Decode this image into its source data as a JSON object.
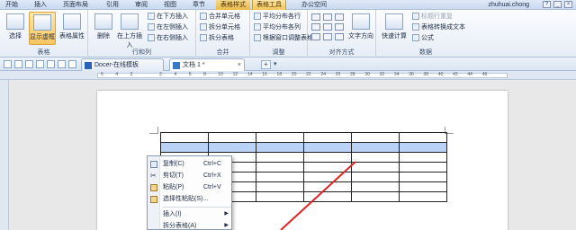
{
  "menu_tabs": [
    {
      "label": "开始"
    },
    {
      "label": "插入"
    },
    {
      "label": "页面布局"
    },
    {
      "label": "引用"
    },
    {
      "label": "审阅"
    },
    {
      "label": "视图"
    },
    {
      "label": "章节"
    },
    {
      "label": "表格样式"
    },
    {
      "label": "表格工具"
    },
    {
      "label": "办公空间"
    }
  ],
  "user": "zhuhuai.chong",
  "ribbon": {
    "select": "选择",
    "show_gridlines": "显示虚框",
    "table_properties": "表格属性",
    "group_table": "表格",
    "delete": "删除",
    "insert_above": "在上方插入",
    "insert_below": "在下方插入",
    "insert_left": "在左侧插入",
    "insert_right": "在右侧插入",
    "group_rows_cols": "行和列",
    "merge_cells": "合并单元格",
    "split_cells": "拆分单元格",
    "split_table": "拆分表格",
    "group_merge": "合并",
    "distribute_rows": "平均分布各行",
    "distribute_cols": "平均分布各列",
    "autofit_window": "根据窗口调整表格",
    "group_adjust": "调整",
    "text_direction": "文字方向",
    "group_alignment": "对齐方式",
    "quick_calc": "快速计算",
    "repeat_header": "标题行重复",
    "convert_to_text": "表格转换成文本",
    "formula": "公式",
    "group_data": "数据"
  },
  "doc_tabs": [
    {
      "label": "Docer-在线模板"
    },
    {
      "label": "文档 1 *"
    }
  ],
  "ruler_numbers": [
    "6",
    "4",
    "2",
    "",
    "2",
    "4",
    "6",
    "8",
    "10",
    "12",
    "14",
    "16",
    "18",
    "20",
    "22",
    "24",
    "26",
    "28",
    "30",
    "32",
    "34",
    "36",
    "38",
    "40",
    "42",
    "44",
    "46"
  ],
  "table": {
    "rows": 7,
    "cols": 6,
    "selected_row": 1
  },
  "context_menu": [
    {
      "label": "复制(C)",
      "shortcut": "Ctrl+C"
    },
    {
      "label": "剪切(T)",
      "shortcut": "Ctrl+X"
    },
    {
      "label": "粘贴(P)",
      "shortcut": "Ctrl+V"
    },
    {
      "label": "选择性粘贴(S)...",
      "shortcut": ""
    },
    {
      "label": "插入(I)",
      "shortcut": ""
    },
    {
      "label": "拆分表格(A)",
      "shortcut": ""
    }
  ],
  "colors": {
    "annotation_line": "#e02424",
    "selection": "#b9d2f5",
    "context_tab": "#f2c55b"
  }
}
